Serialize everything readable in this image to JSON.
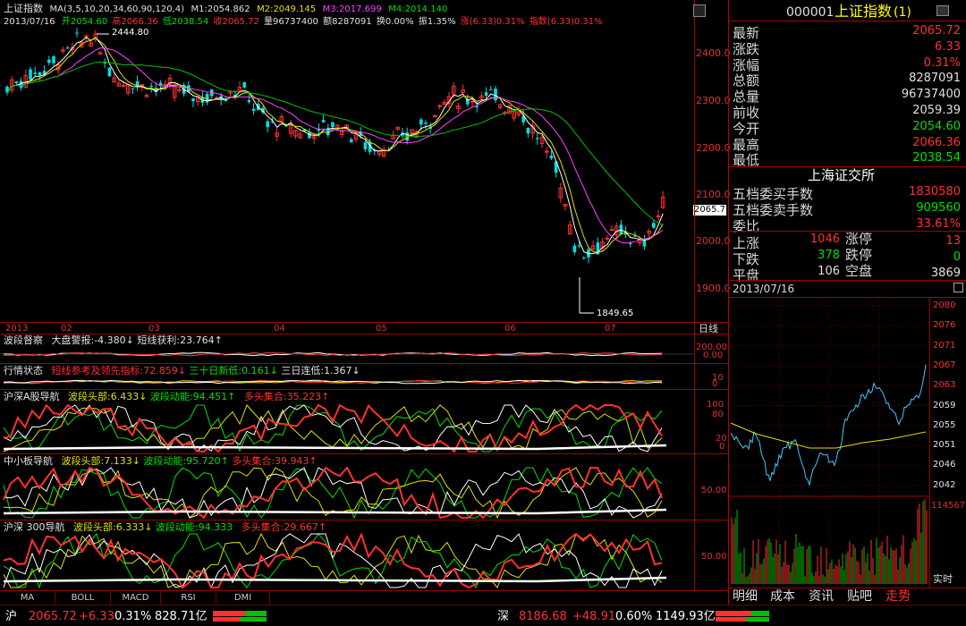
{
  "header": {
    "index_name": "上证指数",
    "ma_params": "MA(3,5,10,20,34,60,90,120,4)",
    "m1": "M1:2054.862",
    "m2": "M2:2049.145",
    "m3": "M3:2017.699",
    "m4": "M4:2014.140",
    "date": "2013/07/16",
    "open": "开2054.60",
    "high": "高2066.36",
    "low": "低2038.54",
    "close": "收2065.72",
    "volume": "量96737400",
    "amount": "额8287091",
    "turnover": "换0.00%",
    "amplitude": "振1.35%",
    "rise": "涨(6.33)0.31%",
    "index_chg": "指数(6.33)0.31%"
  },
  "main_chart": {
    "price_axis": [
      "2400.0",
      "2300.0",
      "2200.0",
      "2100.0",
      "2000.0",
      "1900.0"
    ],
    "current_price_label": "2065.7",
    "high_marker": "2444.80",
    "low_marker": "1849.65",
    "months": [
      "2013",
      "02",
      "03",
      "04",
      "05",
      "06",
      "07"
    ],
    "period_label": "日线",
    "colors": {
      "up": "#ff3030",
      "down": "#00e0e0",
      "ma_white": "#ffffff",
      "ma_yellow": "#e0e000",
      "ma_magenta": "#ff40ff",
      "ma_green": "#00c000"
    }
  },
  "panels": {
    "p1": {
      "name": "波段督察",
      "a": "大盘警报:-4.380↓",
      "b": "短线获利:23.764↑",
      "axis": [
        "200.00",
        "0.00"
      ]
    },
    "p2": {
      "name": "行情状态",
      "a": "短线参考及领先指标:72.859↓",
      "b": "三十日新低:0.161↓",
      "c": "三日连低:1.367↓",
      "axis": [
        "10",
        "0"
      ]
    },
    "p3": {
      "name": "沪深A股导航",
      "a": "波段头部:6.433↓",
      "b": "波段动能:94.451↑",
      "c": "多头集合:35.223↑",
      "axis": [
        "100",
        "80",
        "20",
        "0"
      ]
    },
    "p4": {
      "name": "中小板导航",
      "a": "波段头部:7.133↓",
      "b": "波段动能:95.720↑",
      "c": "多头集合:39.943↑",
      "axis": [
        "50.00"
      ]
    },
    "p5": {
      "name": "沪深 300导航",
      "a": "波段头部:6.333↓",
      "b": "波段动能:94.333",
      "c": "多头集合:29.667↑",
      "axis": [
        "50.00"
      ]
    }
  },
  "bottom_tabs": [
    "MA",
    "BOLL",
    "MACD",
    "RSI",
    "DMI"
  ],
  "quote": {
    "code": "000001",
    "name": "上证指数",
    "suffix": "(1)",
    "rows": [
      {
        "label": "最新",
        "value": "2065.72",
        "color": "#ff3030"
      },
      {
        "label": "涨跌",
        "value": "6.33",
        "color": "#ff3030"
      },
      {
        "label": "涨幅",
        "value": "0.31%",
        "color": "#ff3030"
      },
      {
        "label": "总额",
        "value": "8287091",
        "color": "#e0e0e0"
      },
      {
        "label": "总量",
        "value": "96737400",
        "color": "#e0e0e0"
      },
      {
        "label": "前收",
        "value": "2059.39",
        "color": "#e0e0e0"
      },
      {
        "label": "今开",
        "value": "2054.60",
        "color": "#00e000"
      },
      {
        "label": "最高",
        "value": "2066.36",
        "color": "#ff3030"
      },
      {
        "label": "最低",
        "value": "2038.54",
        "color": "#00e000"
      }
    ],
    "exchange": "上海证交所",
    "buy_label": "五档委买手数",
    "buy_value": "1830580",
    "sell_label": "五档委卖手数",
    "sell_value": "909560",
    "ratio_label": "委比",
    "ratio_value": "33.61%",
    "up_label": "上涨",
    "up_value": "1046",
    "limit_up_label": "涨停",
    "limit_up_value": "13",
    "down_label": "下跌",
    "down_value": "378",
    "limit_down_label": "跌停",
    "limit_down_value": "0",
    "flat_label": "平盘",
    "flat_value": "106",
    "empty_label": "空盘",
    "empty_value": "3869"
  },
  "intraday": {
    "date": "2013/07/16",
    "axis": [
      "2080",
      "2076",
      "2071",
      "2067",
      "2063",
      "2059",
      "2055",
      "2051",
      "2046",
      "2042"
    ],
    "vol_top": "114567",
    "realtime_label": "实时"
  },
  "right_tabs": [
    "明细",
    "成本",
    "资讯",
    "贴吧",
    "走势"
  ],
  "status": {
    "sh_label": "沪",
    "sh_price": "2065.72",
    "sh_chg": "+6.33",
    "sh_pct": "0.31%",
    "sh_amt": "828.71亿",
    "sz_label": "深",
    "sz_price": "8186.68",
    "sz_chg": "+48.91",
    "sz_pct": "0.60%",
    "sz_amt": "1149.93亿"
  }
}
